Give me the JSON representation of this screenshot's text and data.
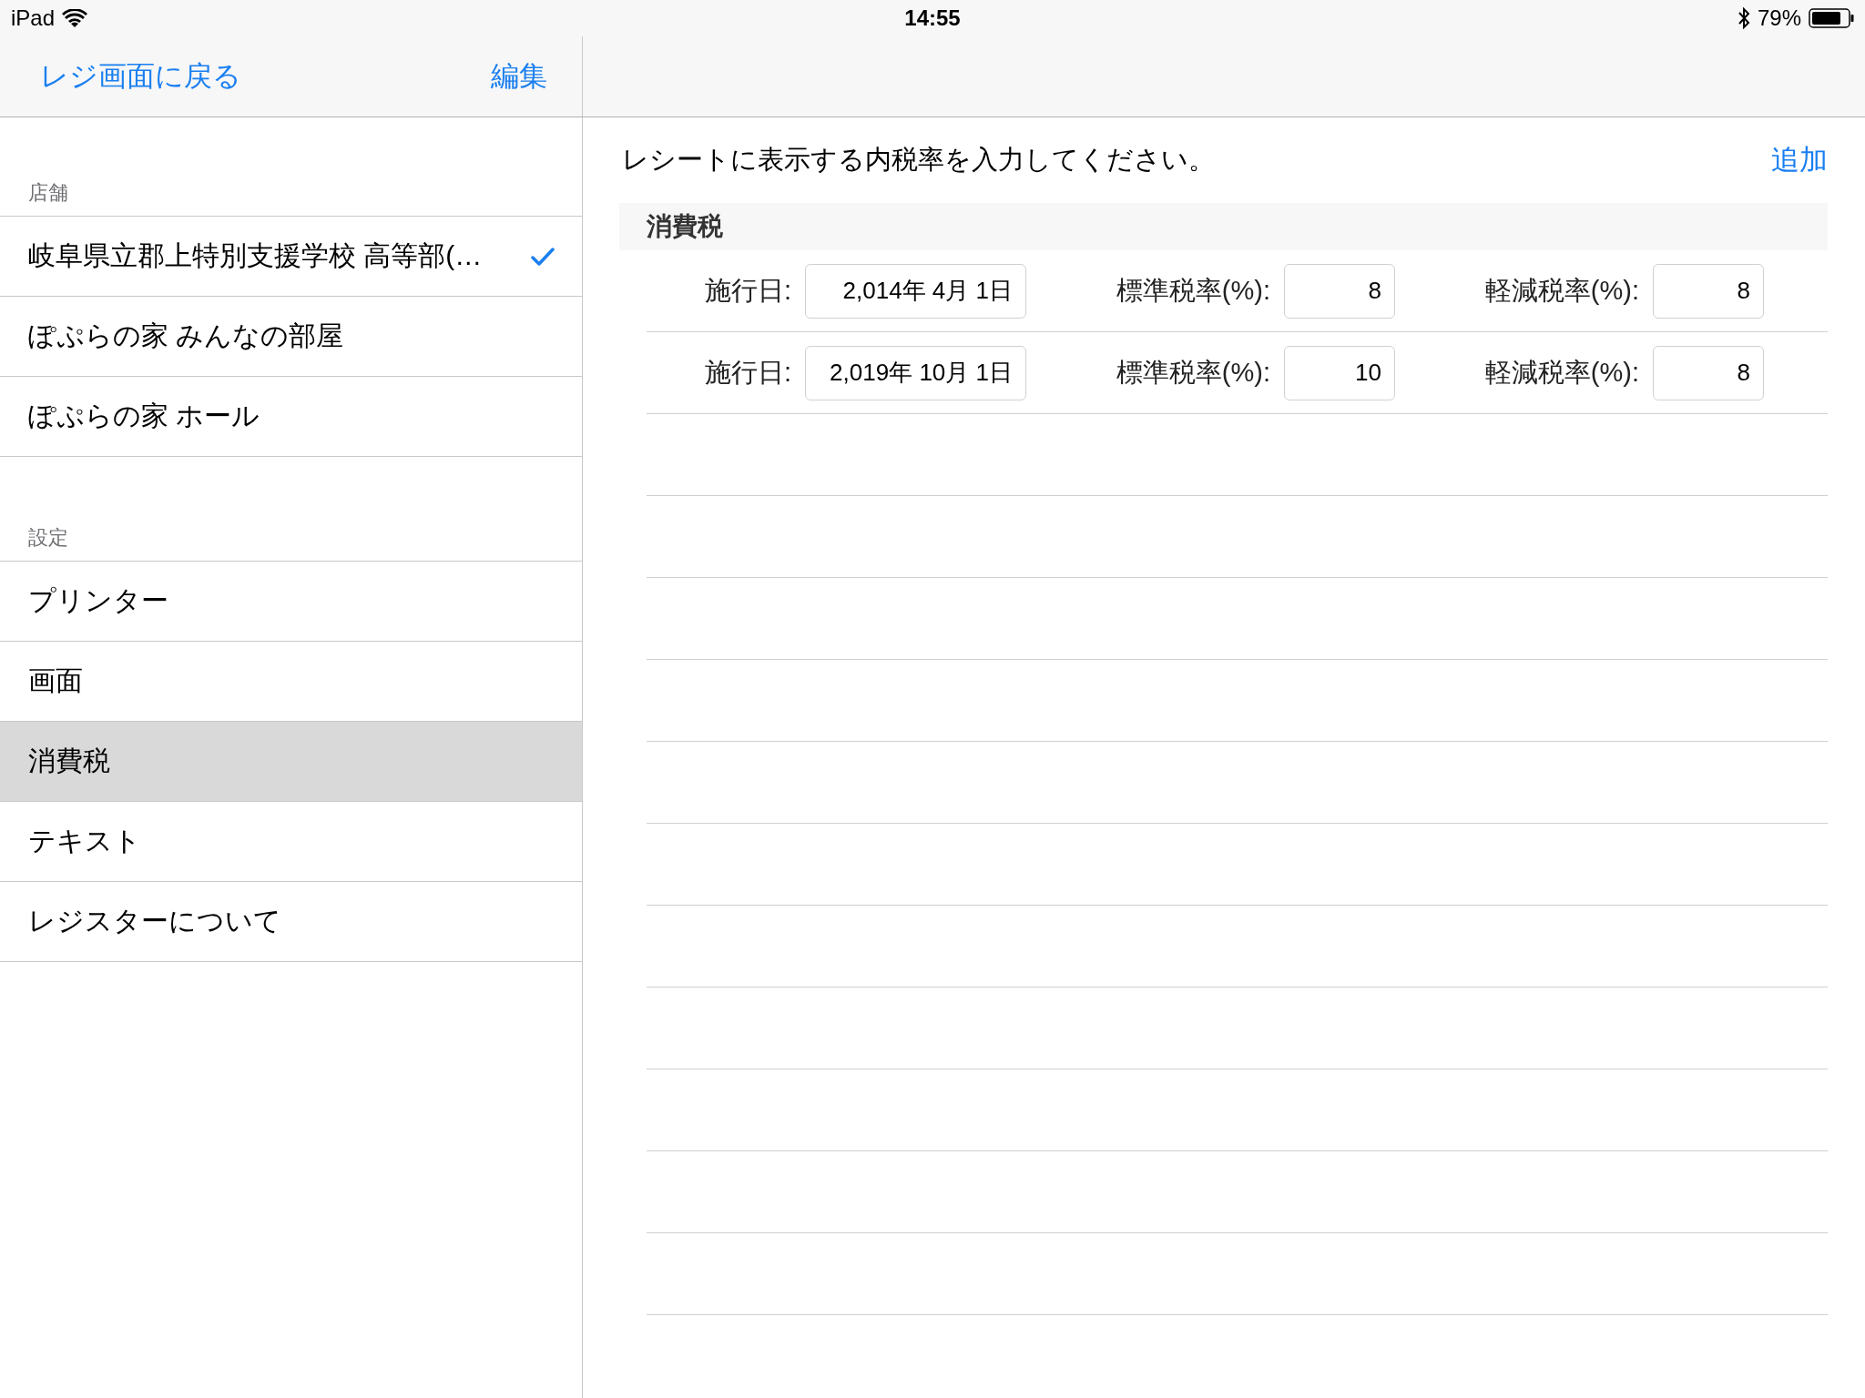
{
  "status_bar": {
    "device": "iPad",
    "time": "14:55",
    "battery": "79%"
  },
  "nav": {
    "back": "レジ画面に戻る",
    "edit": "編集"
  },
  "sidebar": {
    "sections": [
      {
        "header": "店舗",
        "items": [
          {
            "label": "岐阜県立郡上特別支援学校 高等部(…",
            "checked": true,
            "selected": false
          },
          {
            "label": "ぽぷらの家 みんなの部屋",
            "checked": false,
            "selected": false
          },
          {
            "label": "ぽぷらの家 ホール",
            "checked": false,
            "selected": false
          }
        ]
      },
      {
        "header": "設定",
        "items": [
          {
            "label": "プリンター",
            "checked": false,
            "selected": false
          },
          {
            "label": "画面",
            "checked": false,
            "selected": false
          },
          {
            "label": "消費税",
            "checked": false,
            "selected": true
          },
          {
            "label": "テキスト",
            "checked": false,
            "selected": false
          },
          {
            "label": "レジスターについて",
            "checked": false,
            "selected": false
          }
        ]
      }
    ]
  },
  "content": {
    "instruction": "レシートに表示する内税率を入力してください。",
    "add": "追加",
    "section_header": "消費税",
    "rows": [
      {
        "date_label": "施行日:",
        "date": "2,014年 4月 1日",
        "standard_label": "標準税率(%):",
        "standard": "8",
        "reduced_label": "軽減税率(%):",
        "reduced": "8"
      },
      {
        "date_label": "施行日:",
        "date": "2,019年 10月 1日",
        "standard_label": "標準税率(%):",
        "standard": "10",
        "reduced_label": "軽減税率(%):",
        "reduced": "8"
      }
    ]
  }
}
